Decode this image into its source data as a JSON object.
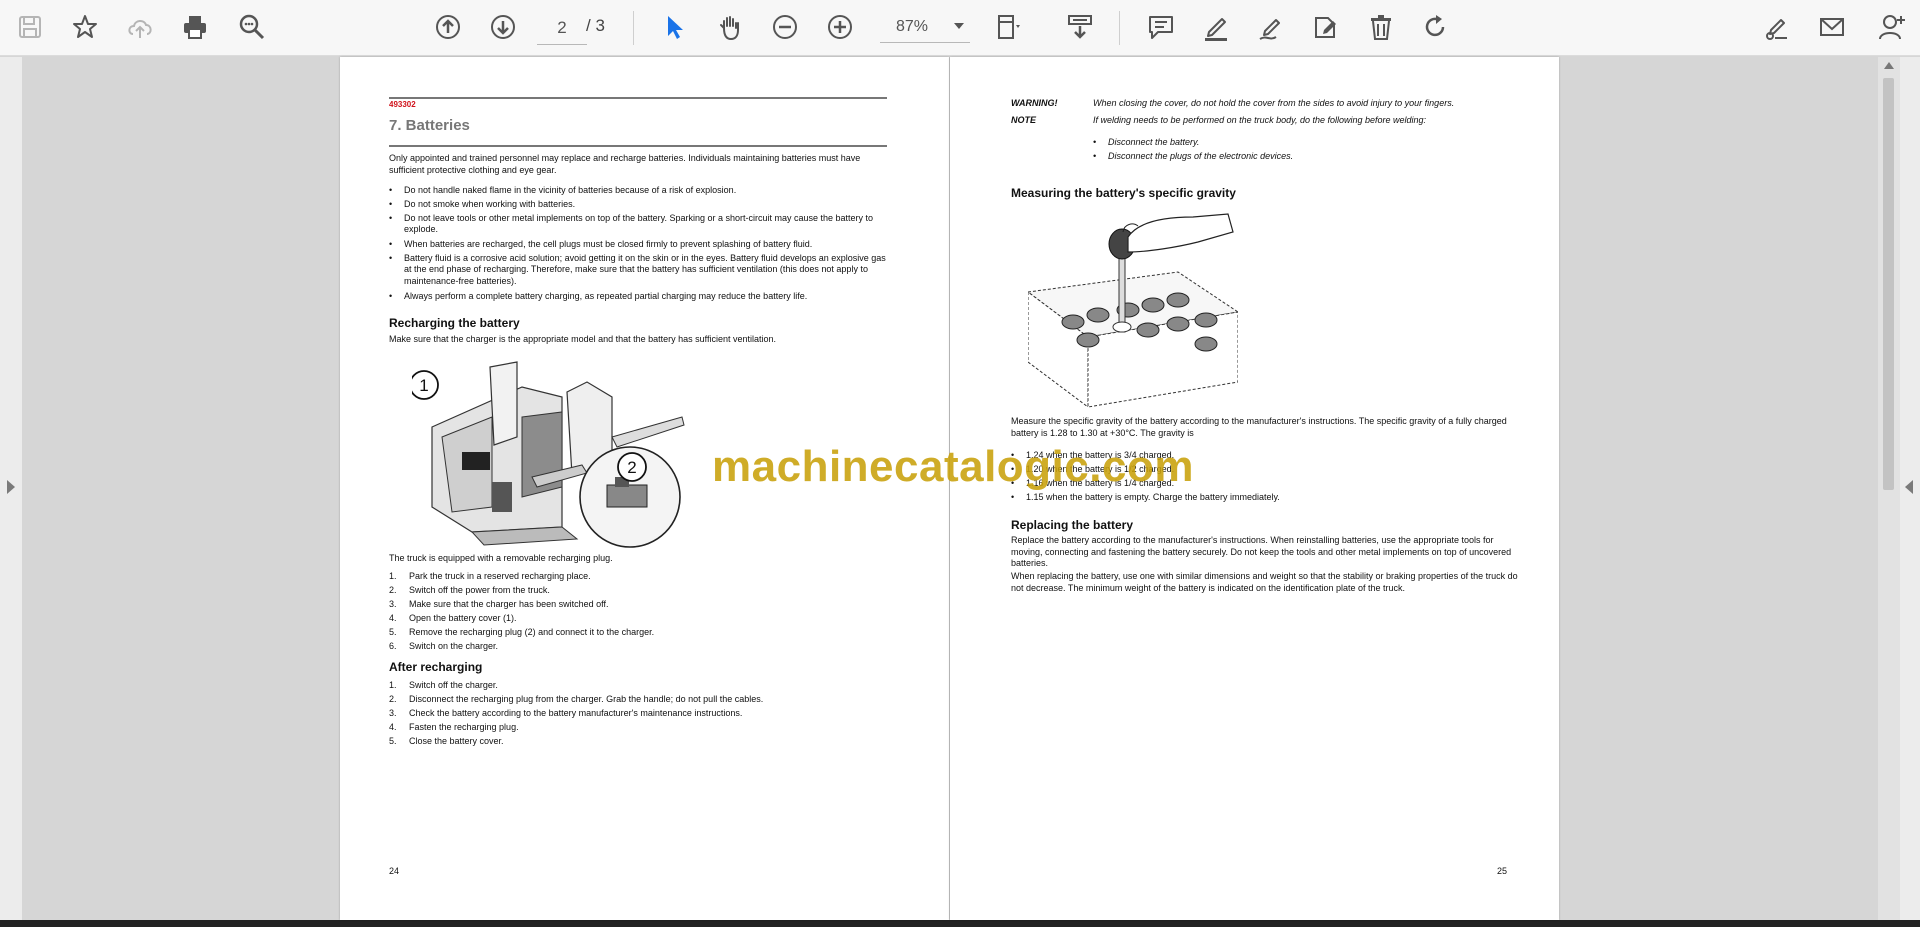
{
  "toolbar": {
    "page_current": "2",
    "page_total": "/ 3",
    "zoom": "87%",
    "icons": [
      "save-icon",
      "bookmark-star-icon",
      "cloud-upload-icon",
      "print-icon",
      "zoom-search-icon",
      "page-up-icon",
      "page-down-icon",
      "select-cursor-icon",
      "hand-pan-icon",
      "zoom-out-icon",
      "zoom-in-icon",
      "page-fit-icon",
      "scroll-mode-icon",
      "comment-icon",
      "highlight-pen-icon",
      "draw-icon",
      "stamp-icon",
      "delete-icon",
      "rotate-icon",
      "sign-icon",
      "email-icon",
      "add-user-icon"
    ],
    "accent_color": "#1a73e8"
  },
  "watermark": "machinecatalogic.com",
  "page_left": {
    "doc_number": "493302",
    "chapter_title": "7. Batteries",
    "intro": "Only appointed and trained personnel may replace and recharge batteries. Individuals maintaining batteries must have sufficient protective clothing and eye gear.",
    "bullets": [
      "Do not handle naked flame in the vicinity of batteries because of a risk of explosion.",
      "Do not smoke when working with batteries.",
      "Do not leave tools or other metal implements on top of the battery. Sparking or a short-circuit may cause the battery to explode.",
      "When batteries are recharged, the cell plugs must be closed firmly to prevent splashing of battery fluid.",
      "Battery fluid is a corrosive acid solution; avoid getting it on the skin or in the eyes. Battery fluid develops an explosive gas at the end phase of recharging. Therefore, make sure that the battery has sufficient ventilation (this does not apply to maintenance-free batteries).",
      "Always perform a complete battery charging, as repeated partial charging may reduce the battery life."
    ],
    "recharging_heading": "Recharging the battery",
    "recharging_intro": "Make sure that the charger is the appropriate model and that the battery has sufficient ventilation.",
    "callout_1": "1",
    "callout_2": "2",
    "plug_text": "The truck is equipped with a removable recharging plug.",
    "steps": [
      {
        "n": "1.",
        "t": "Park the truck in a reserved recharging place."
      },
      {
        "n": "2.",
        "t": "Switch off the power from the truck."
      },
      {
        "n": "3.",
        "t": "Make sure that the charger has been switched off."
      },
      {
        "n": "4.",
        "t": "Open the battery cover (1)."
      },
      {
        "n": "5.",
        "t": "Remove the recharging plug (2) and connect it to the charger."
      },
      {
        "n": "6.",
        "t": "Switch on the charger."
      }
    ],
    "after_heading": "After recharging",
    "after_steps": [
      {
        "n": "1.",
        "t": "Switch off the charger."
      },
      {
        "n": "2.",
        "t": "Disconnect the recharging plug from the charger. Grab the handle; do not pull the cables."
      },
      {
        "n": "3.",
        "t": "Check the battery according to the battery manufacturer's maintenance instructions."
      },
      {
        "n": "4.",
        "t": "Fasten the recharging plug."
      },
      {
        "n": "5.",
        "t": "Close the battery cover."
      }
    ],
    "page_number": "24"
  },
  "page_right": {
    "warning_label": "WARNING!",
    "warning_text": "When closing the cover, do not hold the cover from the sides to avoid injury to your fingers.",
    "note_label": "NOTE",
    "note_text": "If welding needs to be performed on the truck body, do the following before welding:",
    "note_bullets": [
      "Disconnect the battery.",
      "Disconnect the plugs of the electronic devices."
    ],
    "gravity_heading": "Measuring the battery's specific gravity",
    "gravity_text": "Measure the specific gravity of the battery according to the manufacturer's instructions. The specific gravity of a fully charged battery is 1.28 to 1.30 at +30°C. The gravity is",
    "gravity_bullets": [
      "1.24 when the battery is 3/4 charged.",
      "1.20 when the battery is 1/2 charged.",
      "1.16 when the battery is 1/4 charged.",
      "1.15 when the battery is empty. Charge the battery immediately."
    ],
    "replacing_heading": "Replacing the battery",
    "replacing_text_1": "Replace the battery according to the manufacturer's instructions. When reinstalling batteries, use the appropriate tools for moving, connecting and fastening the battery securely. Do not keep the tools and other metal implements on top of uncovered batteries.",
    "replacing_text_2": "When replacing the battery, use one with similar dimensions and weight so that the stability or braking properties of the truck do not decrease. The minimum weight of the battery is indicated on the identification plate of the truck.",
    "page_number": "25"
  }
}
